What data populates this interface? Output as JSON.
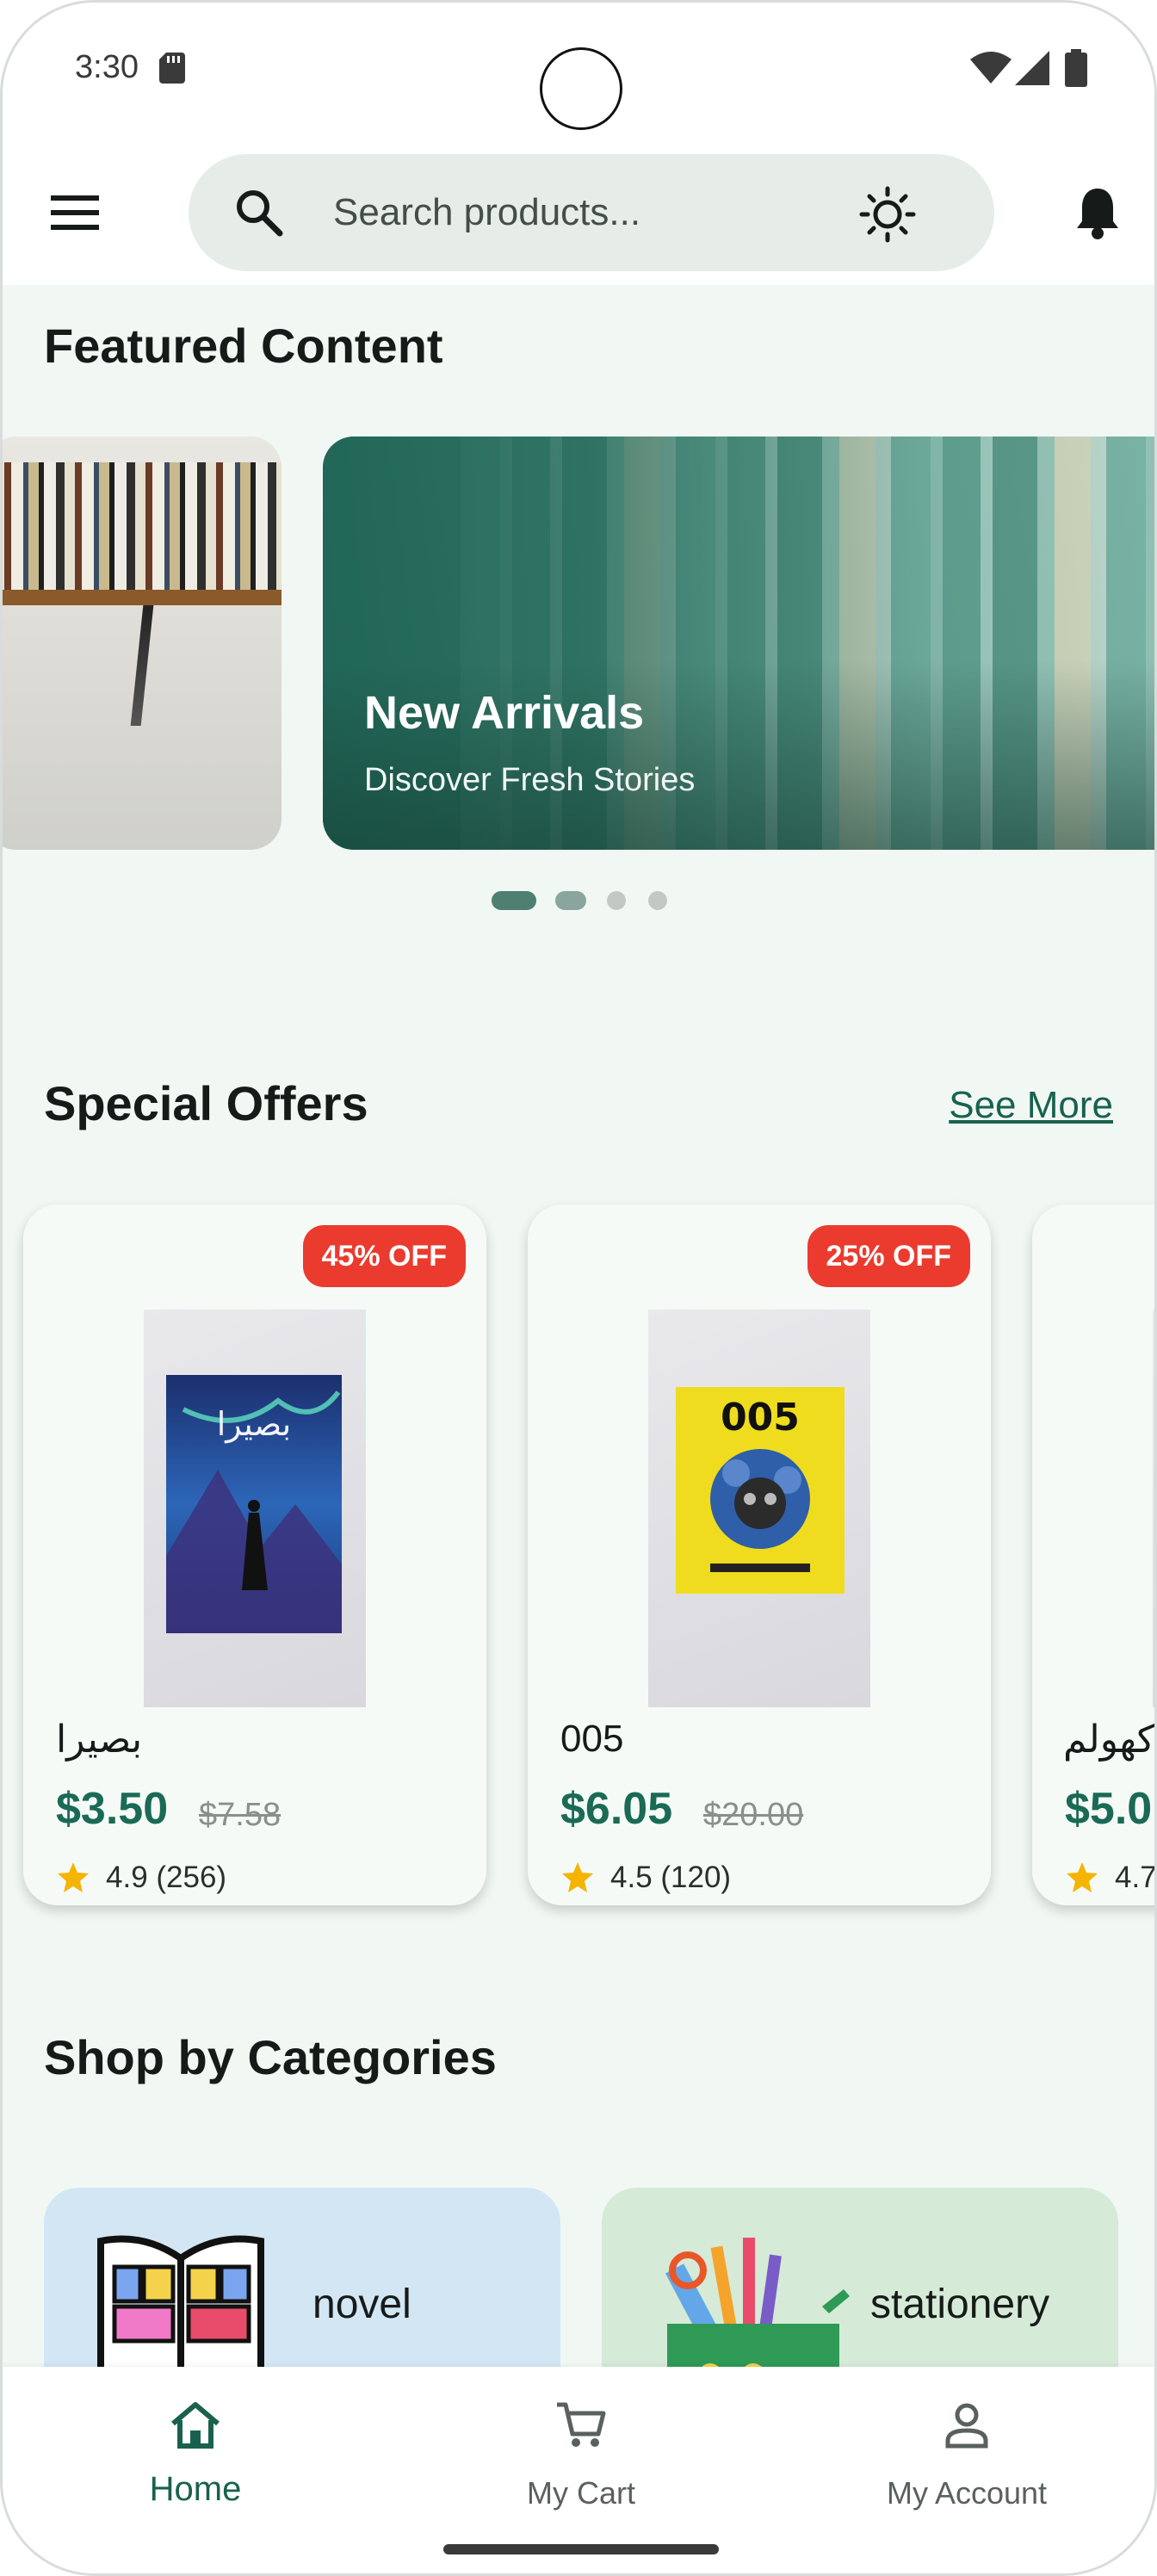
{
  "status_bar": {
    "time": "3:30"
  },
  "search": {
    "placeholder": "Search products..."
  },
  "featured": {
    "title": "Featured Content",
    "banner": {
      "title": "New Arrivals",
      "subtitle": "Discover Fresh Stories"
    },
    "active_slide": 1,
    "slide_count": 4
  },
  "offers": {
    "title": "Special Offers",
    "see_more": "See More",
    "products": [
      {
        "name": "بصيرا",
        "price": "$3.50",
        "old_price": "$7.58",
        "badge": "45% OFF",
        "rating": "4.9 (256)"
      },
      {
        "name": "005",
        "price": "$6.05",
        "old_price": "$20.00",
        "badge": "25% OFF",
        "rating": "4.5 (120)"
      },
      {
        "name": "كهولم",
        "price": "$5.0",
        "rating": "4.7"
      }
    ]
  },
  "categories": {
    "title": "Shop by Categories",
    "items": [
      {
        "label": "novel",
        "color": "#d3e6f4"
      },
      {
        "label": "stationery",
        "color": "#d6ead8"
      }
    ]
  },
  "bottom_nav": {
    "items": [
      {
        "label": "Home",
        "icon": "home-icon",
        "active": true
      },
      {
        "label": "My Cart",
        "icon": "cart-icon",
        "active": false
      },
      {
        "label": "My Account",
        "icon": "account-icon",
        "active": false
      }
    ]
  },
  "colors": {
    "primary": "#19614f",
    "badge": "#ea3b2e",
    "star": "#f5b400",
    "background": "#f1f8f4"
  }
}
